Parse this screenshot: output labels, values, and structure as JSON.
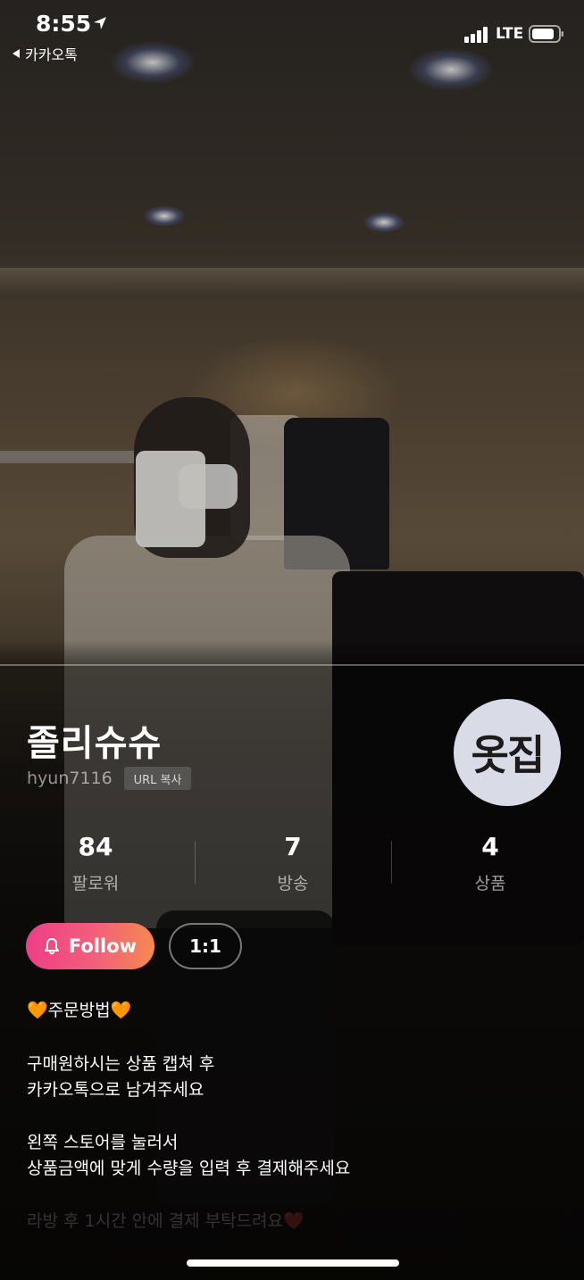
{
  "status_bar": {
    "time": "8:55",
    "back_app": "카카오톡",
    "network": "LTE"
  },
  "profile": {
    "name": "졸리슈슈",
    "handle": "hyun7116",
    "url_copy_label": "URL 복사",
    "logo_text": "옷집"
  },
  "stats": [
    {
      "value": "84",
      "label": "팔로워"
    },
    {
      "value": "7",
      "label": "방송"
    },
    {
      "value": "4",
      "label": "상품"
    }
  ],
  "actions": {
    "follow_label": "Follow",
    "dm_label": "1:1"
  },
  "description": {
    "heading": "🧡주문방법🧡",
    "line1": "구매원하시는 상품 캡쳐 후",
    "line2": "카카오톡으로 남겨주세요",
    "line3": "왼쪽 스토어를 눌러서",
    "line4": "상품금액에 맞게 수량을 입력 후 결제해주세요",
    "line5_faded": "라방 후 1시간 안에 결제 부탁드려요❤️"
  },
  "colors": {
    "follow_gradient_start": "#ee3e86",
    "follow_gradient_end": "#f6894e",
    "logo_bg": "#d9dce6"
  }
}
